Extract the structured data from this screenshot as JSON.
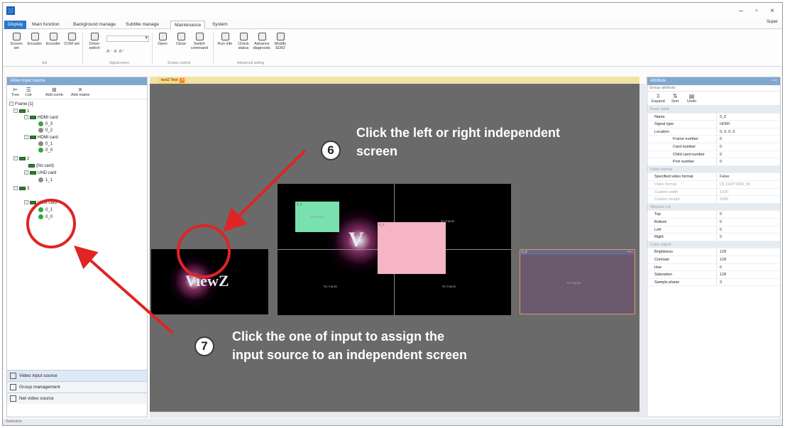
{
  "titlebar": {
    "min": "–",
    "max": "▫",
    "close": "×"
  },
  "menu": {
    "file": "Display",
    "tabs": [
      "Main function",
      "Background manage",
      "Subtitle manage",
      "Maintenance",
      "System"
    ],
    "user": "Super"
  },
  "ribbon": {
    "buttons_left": [
      "Screen set",
      "Encoder",
      "Encoder",
      "COM set"
    ],
    "group1_label": "Set",
    "driver_switch": "Driver switch",
    "signal_group_label": "Signal menu",
    "screen_buttons": [
      "Open",
      "Close",
      "Switch command"
    ],
    "screen_group_label": "Screen control",
    "advanced_buttons": [
      "Run info",
      "Check status",
      "Advance diagnostic",
      "Modify EDID"
    ],
    "advanced_group_label": "Advanced setting"
  },
  "left_panel": {
    "title": "Video input source",
    "toolbar": [
      "Tree",
      "List",
      "Add comb",
      "Add matrix"
    ],
    "tree": {
      "root": "Frame [1]",
      "groups": [
        {
          "name": "1",
          "cards": [
            {
              "name": "HDMI card",
              "inputs": [
                "0_3",
                "0_2"
              ]
            },
            {
              "name": "HDMI card",
              "inputs": [
                "0_1",
                "0_0"
              ]
            }
          ]
        },
        {
          "name": "2",
          "cards": [
            {
              "name": "(No card)",
              "inputs": []
            },
            {
              "name": "UHD card",
              "inputs": [
                "1_1"
              ]
            }
          ]
        },
        {
          "name": "3",
          "cards": [
            {
              "name": "HDbt card",
              "inputs": [
                "0_1",
                "0_0"
              ]
            }
          ]
        }
      ]
    },
    "bottom_tabs": [
      "Video input source",
      "Group management",
      "Net video source"
    ],
    "status": "Selection"
  },
  "canvas": {
    "doc_tab": "test2  Test",
    "screens": {
      "left_logo": "ViewZ",
      "main_logo": "V",
      "window_label_a": "0_2",
      "window_label_b": "0_3",
      "cell_label": "No Inputs",
      "right_window_title": "0_0",
      "right_window_label": "No Inputs"
    }
  },
  "attributes": {
    "title": "Attribute",
    "subtitle": "Group attribute",
    "toolbar": [
      "Expand",
      "Sort",
      "Undo"
    ],
    "rows": [
      {
        "section": "Basic attrib"
      },
      {
        "key": "Name",
        "value": "0_0"
      },
      {
        "key": "Signal type",
        "value": "HDMI"
      },
      {
        "key": "Location",
        "value": "0, 0, 0, 0"
      },
      {
        "key": "Frame number",
        "value": "0",
        "indent": true
      },
      {
        "key": "Card number",
        "value": "0",
        "indent": true
      },
      {
        "key": "Child card number",
        "value": "0",
        "indent": true
      },
      {
        "key": "Port number",
        "value": "0",
        "indent": true
      },
      {
        "section": "Video format"
      },
      {
        "key": "Specified video format",
        "value": "False"
      },
      {
        "key": "Video format",
        "value": "[3] 1920*1080_60",
        "dim": true
      },
      {
        "key": "Custom width",
        "value": "1920",
        "dim": true
      },
      {
        "key": "Custom height",
        "value": "1080",
        "dim": true
      },
      {
        "section": "Window cut"
      },
      {
        "key": "Top",
        "value": "0"
      },
      {
        "key": "Bottom",
        "value": "0"
      },
      {
        "key": "Left",
        "value": "0"
      },
      {
        "key": "Right",
        "value": "0"
      },
      {
        "section": "Color adjust"
      },
      {
        "key": "Brightness",
        "value": "128"
      },
      {
        "key": "Contrast",
        "value": "128"
      },
      {
        "key": "Hue",
        "value": "0"
      },
      {
        "key": "Saturation",
        "value": "128"
      },
      {
        "key": "Sample phase",
        "value": "3"
      }
    ]
  },
  "annotations": {
    "step6_number": "6",
    "step6_line1": "Click the left or right independent",
    "step6_line2": "screen",
    "step7_number": "7",
    "step7_line1": "Click the one of input to assign the",
    "step7_line2": "input source to an independent screen",
    "color": "#e02424"
  },
  "colors": {
    "panel_header": "#7fa7cf",
    "canvas_bg": "#6a6a6a",
    "window_green": "#79e0b0",
    "window_pink": "#f5b5c4",
    "right_window": "#6b5a6e",
    "input_active": "#2fa83a"
  }
}
